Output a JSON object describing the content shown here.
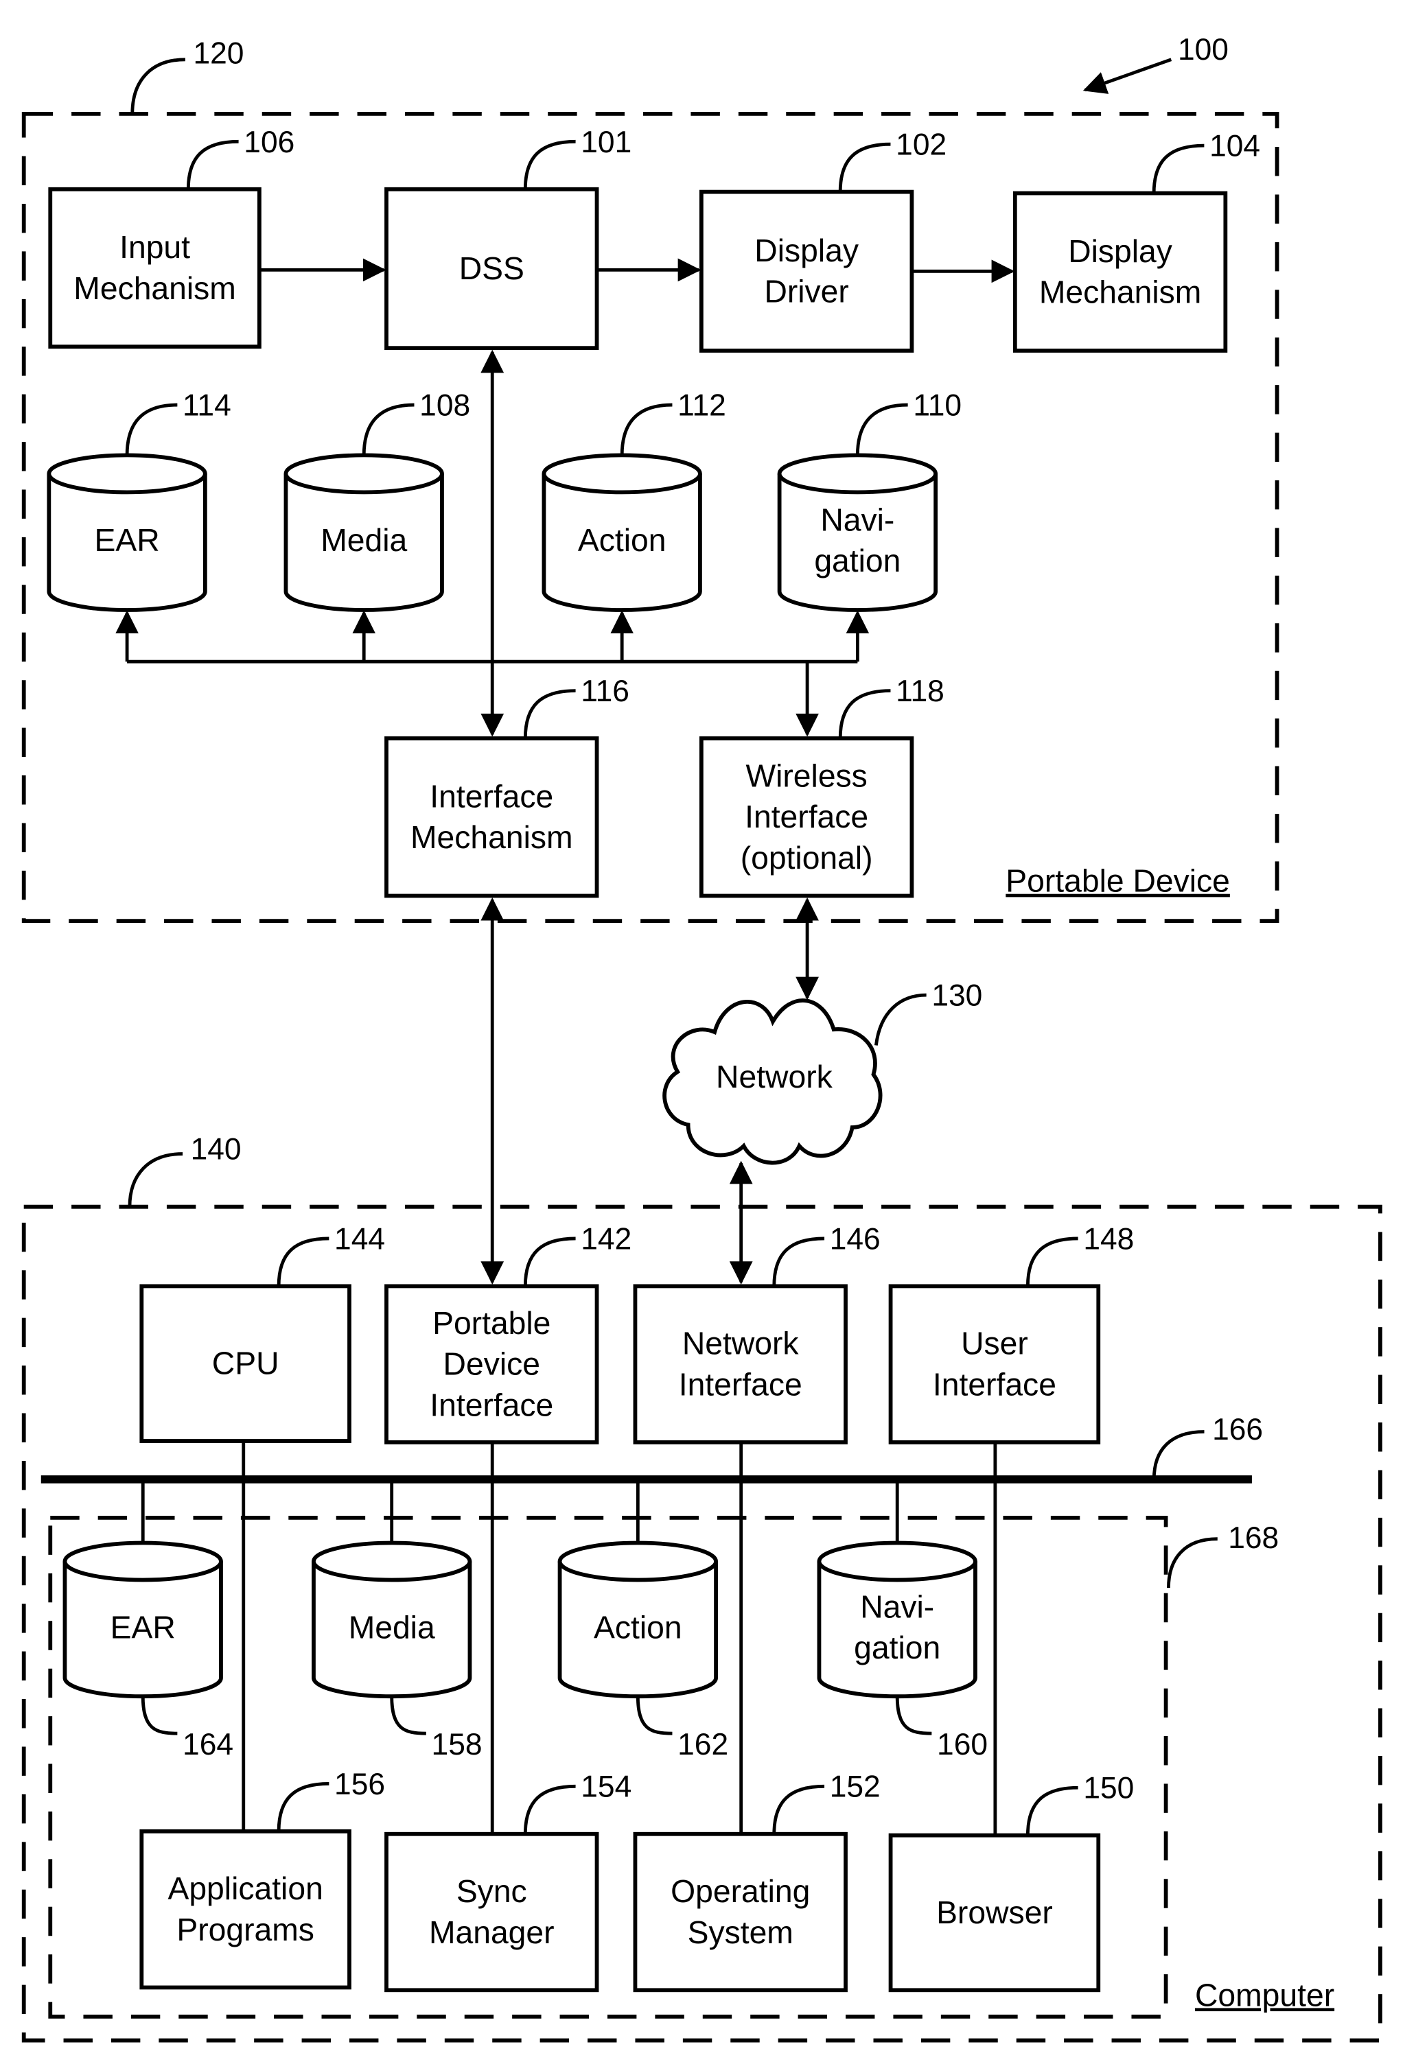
{
  "figure": {
    "ref": "100",
    "portable_device": {
      "ref": "120",
      "title": "Portable Device",
      "blocks": {
        "input": {
          "ref": "106",
          "lines": [
            "Input",
            "Mechanism"
          ]
        },
        "dss": {
          "ref": "101",
          "lines": [
            "DSS"
          ]
        },
        "display_driver": {
          "ref": "102",
          "lines": [
            "Display",
            "Driver"
          ]
        },
        "display_mechanism": {
          "ref": "104",
          "lines": [
            "Display",
            "Mechanism"
          ]
        },
        "interface_mechanism": {
          "ref": "116",
          "lines": [
            "Interface",
            "Mechanism"
          ]
        },
        "wireless_interface": {
          "ref": "118",
          "lines": [
            "Wireless",
            "Interface",
            "(optional)"
          ]
        }
      },
      "stores": [
        {
          "key": "ear",
          "ref": "114",
          "lines": [
            "EAR"
          ]
        },
        {
          "key": "media",
          "ref": "108",
          "lines": [
            "Media"
          ]
        },
        {
          "key": "action",
          "ref": "112",
          "lines": [
            "Action"
          ]
        },
        {
          "key": "navigation",
          "ref": "110",
          "lines": [
            "Navi-",
            "gation"
          ]
        }
      ]
    },
    "network": {
      "ref": "130",
      "label": "Network"
    },
    "computer": {
      "ref": "140",
      "title": "Computer",
      "bus_ref": "166",
      "storage_group_ref": "168",
      "interfaces": [
        {
          "key": "cpu",
          "ref": "144",
          "lines": [
            "CPU"
          ]
        },
        {
          "key": "portable_device_interface",
          "ref": "142",
          "lines": [
            "Portable",
            "Device",
            "Interface"
          ]
        },
        {
          "key": "network_interface",
          "ref": "146",
          "lines": [
            "Network",
            "Interface"
          ]
        },
        {
          "key": "user_interface",
          "ref": "148",
          "lines": [
            "User",
            "Interface"
          ]
        }
      ],
      "stores": [
        {
          "key": "ear",
          "ref": "164",
          "lines": [
            "EAR"
          ]
        },
        {
          "key": "media",
          "ref": "158",
          "lines": [
            "Media"
          ]
        },
        {
          "key": "action",
          "ref": "162",
          "lines": [
            "Action"
          ]
        },
        {
          "key": "navigation",
          "ref": "160",
          "lines": [
            "Navi-",
            "gation"
          ]
        }
      ],
      "programs": [
        {
          "key": "application_programs",
          "ref": "156",
          "lines": [
            "Application",
            "Programs"
          ]
        },
        {
          "key": "sync_manager",
          "ref": "154",
          "lines": [
            "Sync",
            "Manager"
          ]
        },
        {
          "key": "operating_system",
          "ref": "152",
          "lines": [
            "Operating",
            "System"
          ]
        },
        {
          "key": "browser",
          "ref": "150",
          "lines": [
            "Browser"
          ]
        }
      ]
    }
  }
}
